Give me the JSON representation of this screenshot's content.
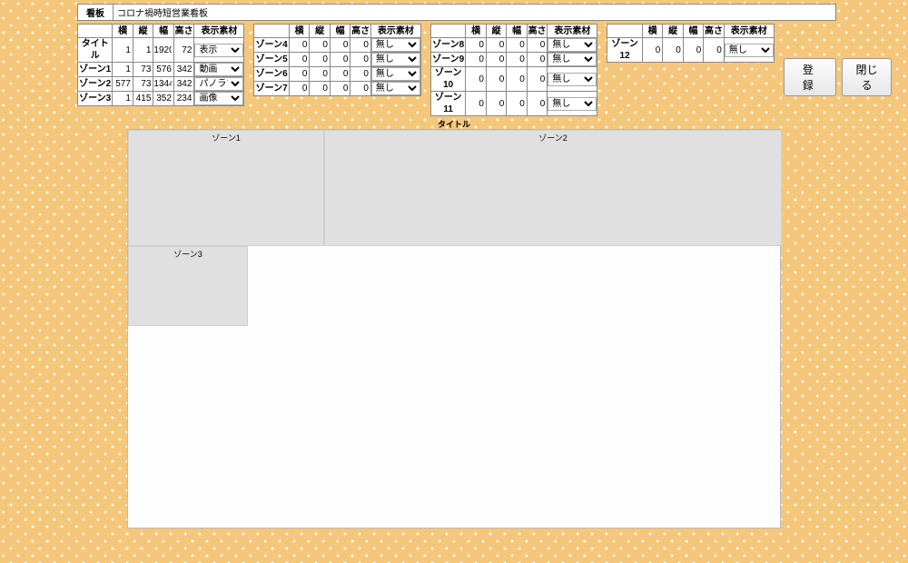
{
  "labels": {
    "kanban": "看板",
    "register": "登 録",
    "close": "閉じる",
    "title_zone": "タイトル"
  },
  "title_value": "コロナ禍時短営業看板",
  "headers": {
    "blank": "",
    "yoko": "横",
    "tate": "縦",
    "haba": "幅",
    "takasa": "高さ",
    "sozai": "表示素材"
  },
  "material_options": [
    "表示",
    "動画",
    "パノラマ",
    "画像",
    "無し"
  ],
  "groups": [
    {
      "rows": [
        {
          "name": "タイトル",
          "yoko": 1,
          "tate": 1,
          "haba": 1920,
          "takasa": 72,
          "mat": "表示"
        },
        {
          "name": "ゾーン1",
          "yoko": 1,
          "tate": 73,
          "haba": 576,
          "takasa": 342,
          "mat": "動画"
        },
        {
          "name": "ゾーン2",
          "yoko": 577,
          "tate": 73,
          "haba": 1344,
          "takasa": 342,
          "mat": "パノラマ"
        },
        {
          "name": "ゾーン3",
          "yoko": 1,
          "tate": 415,
          "haba": 352,
          "takasa": 234,
          "mat": "画像"
        }
      ]
    },
    {
      "rows": [
        {
          "name": "ゾーン4",
          "yoko": 0,
          "tate": 0,
          "haba": 0,
          "takasa": 0,
          "mat": "無し"
        },
        {
          "name": "ゾーン5",
          "yoko": 0,
          "tate": 0,
          "haba": 0,
          "takasa": 0,
          "mat": "無し"
        },
        {
          "name": "ゾーン6",
          "yoko": 0,
          "tate": 0,
          "haba": 0,
          "takasa": 0,
          "mat": "無し"
        },
        {
          "name": "ゾーン7",
          "yoko": 0,
          "tate": 0,
          "haba": 0,
          "takasa": 0,
          "mat": "無し"
        }
      ]
    },
    {
      "rows": [
        {
          "name": "ゾーン8",
          "yoko": 0,
          "tate": 0,
          "haba": 0,
          "takasa": 0,
          "mat": "無し"
        },
        {
          "name": "ゾーン9",
          "yoko": 0,
          "tate": 0,
          "haba": 0,
          "takasa": 0,
          "mat": "無し"
        },
        {
          "name": "ゾーン10",
          "yoko": 0,
          "tate": 0,
          "haba": 0,
          "takasa": 0,
          "mat": "無し"
        },
        {
          "name": "ゾーン11",
          "yoko": 0,
          "tate": 0,
          "haba": 0,
          "takasa": 0,
          "mat": "無し"
        }
      ]
    },
    {
      "rows": [
        {
          "name": "ゾーン12",
          "yoko": 0,
          "tate": 0,
          "haba": 0,
          "takasa": 0,
          "mat": "無し"
        }
      ]
    }
  ],
  "preview": {
    "title": "タイトル",
    "zones": [
      {
        "id": "z1",
        "label": "ゾーン1"
      },
      {
        "id": "z2",
        "label": "ゾーン2"
      },
      {
        "id": "z3",
        "label": "ゾーン3"
      }
    ]
  }
}
